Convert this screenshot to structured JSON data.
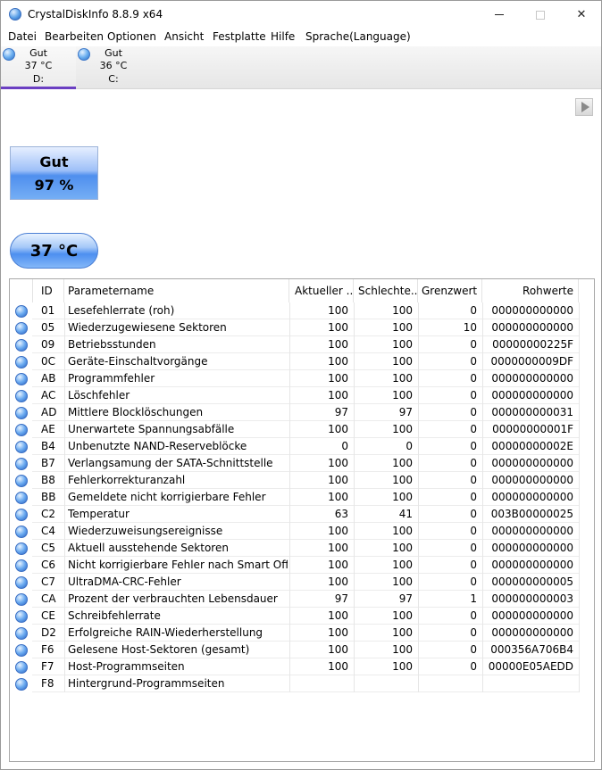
{
  "window": {
    "title": "CrystalDiskInfo 8.8.9 x64",
    "minimize_icon": "minimize-icon",
    "maximize_icon": "maximize-icon",
    "close_icon": "close-icon",
    "close_glyph": "✕"
  },
  "menu": {
    "items": [
      "Datei",
      "Bearbeiten",
      "Optionen",
      "Ansicht",
      "Festplatte",
      "Hilfe",
      "Sprache(Language)"
    ]
  },
  "disks": [
    {
      "status": "Gut",
      "temp": "37 °C",
      "drive": "D:",
      "active": true
    },
    {
      "status": "Gut",
      "temp": "36 °C",
      "drive": "C:",
      "active": false
    }
  ],
  "health": {
    "status": "Gut",
    "percent": "97 %",
    "box_color": "#4f8fee"
  },
  "temperature": {
    "value": "37 °C"
  },
  "smart": {
    "headers": {
      "id": "ID",
      "name": "Parametername",
      "current": "Aktueller ...",
      "worst": "Schlechte...",
      "threshold": "Grenzwert",
      "raw": "Rohwerte"
    },
    "rows": [
      {
        "id": "01",
        "name": "Lesefehlerrate (roh)",
        "current": "100",
        "worst": "100",
        "threshold": "0",
        "raw": "000000000000"
      },
      {
        "id": "05",
        "name": "Wiederzugewiesene Sektoren",
        "current": "100",
        "worst": "100",
        "threshold": "10",
        "raw": "000000000000"
      },
      {
        "id": "09",
        "name": "Betriebsstunden",
        "current": "100",
        "worst": "100",
        "threshold": "0",
        "raw": "00000000225F"
      },
      {
        "id": "0C",
        "name": "Geräte-Einschaltvorgänge",
        "current": "100",
        "worst": "100",
        "threshold": "0",
        "raw": "0000000009DF"
      },
      {
        "id": "AB",
        "name": "Programmfehler",
        "current": "100",
        "worst": "100",
        "threshold": "0",
        "raw": "000000000000"
      },
      {
        "id": "AC",
        "name": "Löschfehler",
        "current": "100",
        "worst": "100",
        "threshold": "0",
        "raw": "000000000000"
      },
      {
        "id": "AD",
        "name": "Mittlere Blocklöschungen",
        "current": "97",
        "worst": "97",
        "threshold": "0",
        "raw": "000000000031"
      },
      {
        "id": "AE",
        "name": "Unerwartete Spannungsabfälle",
        "current": "100",
        "worst": "100",
        "threshold": "0",
        "raw": "00000000001F"
      },
      {
        "id": "B4",
        "name": "Unbenutzte NAND-Reserveblöcke",
        "current": "0",
        "worst": "0",
        "threshold": "0",
        "raw": "00000000002E"
      },
      {
        "id": "B7",
        "name": "Verlangsamung der SATA-Schnittstelle",
        "current": "100",
        "worst": "100",
        "threshold": "0",
        "raw": "000000000000"
      },
      {
        "id": "B8",
        "name": "Fehlerkorrekturanzahl",
        "current": "100",
        "worst": "100",
        "threshold": "0",
        "raw": "000000000000"
      },
      {
        "id": "BB",
        "name": "Gemeldete nicht korrigierbare Fehler",
        "current": "100",
        "worst": "100",
        "threshold": "0",
        "raw": "000000000000"
      },
      {
        "id": "C2",
        "name": "Temperatur",
        "current": "63",
        "worst": "41",
        "threshold": "0",
        "raw": "003B00000025"
      },
      {
        "id": "C4",
        "name": "Wiederzuweisungsereignisse",
        "current": "100",
        "worst": "100",
        "threshold": "0",
        "raw": "000000000000"
      },
      {
        "id": "C5",
        "name": "Aktuell ausstehende Sektoren",
        "current": "100",
        "worst": "100",
        "threshold": "0",
        "raw": "000000000000"
      },
      {
        "id": "C6",
        "name": "Nicht korrigierbare Fehler nach Smart Offlin...",
        "current": "100",
        "worst": "100",
        "threshold": "0",
        "raw": "000000000000"
      },
      {
        "id": "C7",
        "name": "UltraDMA-CRC-Fehler",
        "current": "100",
        "worst": "100",
        "threshold": "0",
        "raw": "000000000005"
      },
      {
        "id": "CA",
        "name": "Prozent der verbrauchten Lebensdauer",
        "current": "97",
        "worst": "97",
        "threshold": "1",
        "raw": "000000000003"
      },
      {
        "id": "CE",
        "name": "Schreibfehlerrate",
        "current": "100",
        "worst": "100",
        "threshold": "0",
        "raw": "000000000000"
      },
      {
        "id": "D2",
        "name": "Erfolgreiche RAIN-Wiederherstellung",
        "current": "100",
        "worst": "100",
        "threshold": "0",
        "raw": "000000000000"
      },
      {
        "id": "F6",
        "name": "Gelesene Host-Sektoren (gesamt)",
        "current": "100",
        "worst": "100",
        "threshold": "0",
        "raw": "000356A706B4"
      },
      {
        "id": "F7",
        "name": "Host-Programmseiten",
        "current": "100",
        "worst": "100",
        "threshold": "0",
        "raw": "00000E05AEDD"
      },
      {
        "id": "F8",
        "name": "Hintergrund-Programmseiten",
        "current": "",
        "worst": "",
        "threshold": "",
        "raw": ""
      }
    ]
  }
}
